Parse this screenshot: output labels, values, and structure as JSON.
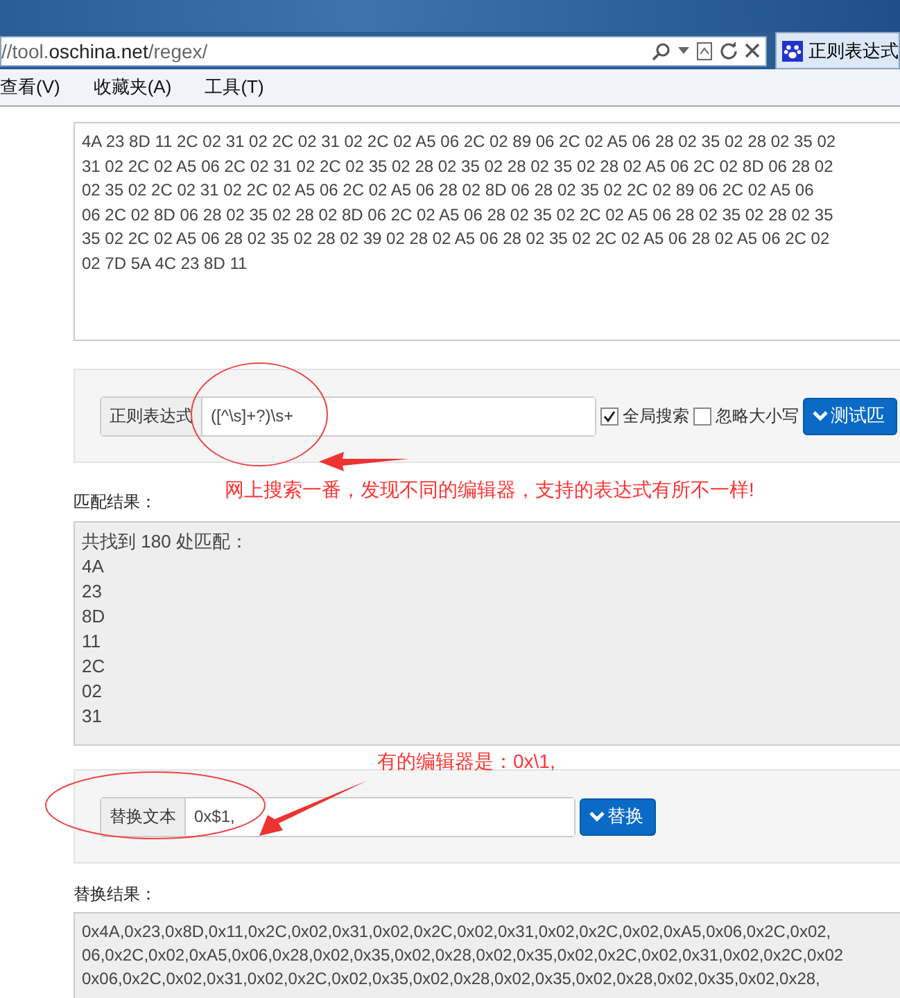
{
  "browser": {
    "address": {
      "prefix": "//tool.",
      "domain": "oschina.net",
      "path": "/regex/"
    },
    "tab_title": "正则表达式",
    "menu": [
      "查看(V)",
      "收藏夹(A)",
      "工具(T)"
    ]
  },
  "source_text": [
    "4A 23 8D 11 2C 02 31 02 2C 02 31 02 2C 02 A5 06 2C 02 89 06 2C 02 A5 06 28 02 35 02 28 02 35 02",
    "31 02 2C 02 A5 06 2C 02 31 02 2C 02 35 02 28 02 35 02 28 02 35 02 28 02 A5 06 2C 02 8D 06 28 02",
    "02 35 02 2C 02 31 02 2C 02 A5 06 2C 02 A5 06 28 02 8D 06 28 02 35 02 2C 02 89 06 2C 02 A5 06",
    "06 2C 02 8D 06 28 02 35 02 28 02 8D 06 2C 02 A5 06 28 02 35 02 2C 02 A5 06 28 02 35 02 28 02 35",
    "35 02 2C 02 A5 06 28 02 35 02 28 02 39 02 28 02 A5 06 28 02 35 02 2C 02 A5 06 28 02 A5 06 2C 02",
    "02 7D 5A 4C 23 8D 11"
  ],
  "regex": {
    "label": "正则表达式",
    "value": "([^\\s]+?)\\s+",
    "options": [
      {
        "label": "全局搜索",
        "checked": true
      },
      {
        "label": "忽略大小写",
        "checked": false
      }
    ],
    "button": "测试匹"
  },
  "match_label": "匹配结果：",
  "match_result": {
    "summary": "共找到 180 处匹配：",
    "items": [
      "4A",
      "23",
      "8D",
      "11",
      "2C",
      "02",
      "31"
    ]
  },
  "replace": {
    "label": "替换文本",
    "value": "0x$1,",
    "button": "替换"
  },
  "replace_label": "替换结果：",
  "replace_result": [
    "0x4A,0x23,0x8D,0x11,0x2C,0x02,0x31,0x02,0x2C,0x02,0x31,0x02,0x2C,0x02,0xA5,0x06,0x2C,0x02,",
    "06,0x2C,0x02,0xA5,0x06,0x28,0x02,0x35,0x02,0x28,0x02,0x35,0x02,0x2C,0x02,0x31,0x02,0x2C,0x02",
    "0x06,0x2C,0x02,0x31,0x02,0x2C,0x02,0x35,0x02,0x28,0x02,0x35,0x02,0x28,0x02,0x35,0x02,0x28,"
  ],
  "annotations": [
    {
      "kind": "note",
      "text": "网上搜索一番，发现不同的编辑器，支持的表达式有所不一样!"
    },
    {
      "kind": "note",
      "text": "有的编辑器是：0x\\1,"
    }
  ]
}
